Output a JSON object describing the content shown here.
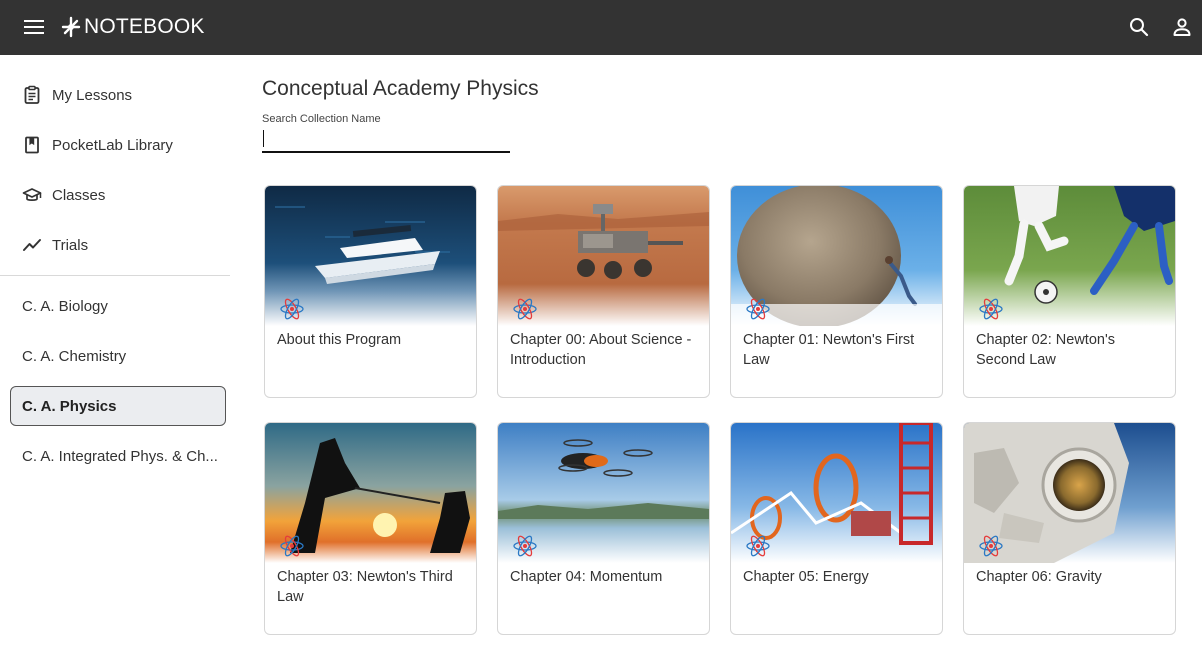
{
  "app": {
    "name": "NOTEBOOK"
  },
  "sidebar": {
    "nav": [
      {
        "label": "My Lessons",
        "icon": "clipboard-icon"
      },
      {
        "label": "PocketLab Library",
        "icon": "book-icon"
      },
      {
        "label": "Classes",
        "icon": "graduation-cap-icon"
      },
      {
        "label": "Trials",
        "icon": "trend-line-icon"
      }
    ],
    "collections": [
      {
        "label": "C. A. Biology",
        "active": false
      },
      {
        "label": "C. A. Chemistry",
        "active": false
      },
      {
        "label": "C. A. Physics",
        "active": true
      },
      {
        "label": "C. A. Integrated Phys. & Ch...",
        "active": false
      }
    ]
  },
  "main": {
    "title": "Conceptual Academy Physics",
    "search": {
      "label": "Search Collection Name",
      "value": "",
      "placeholder": ""
    },
    "cards": [
      {
        "title": "About this Program",
        "image": "catamaran-at-sea"
      },
      {
        "title": "Chapter 00: About Science - Introduction",
        "image": "mars-rover"
      },
      {
        "title": "Chapter 01: Newton's First Law",
        "image": "person-pushing-boulder"
      },
      {
        "title": "Chapter 02: Newton's Second Law",
        "image": "soccer-players"
      },
      {
        "title": "Chapter 03: Newton's Third Law",
        "image": "tug-of-war-sunset"
      },
      {
        "title": "Chapter 04: Momentum",
        "image": "drone-over-lake"
      },
      {
        "title": "Chapter 05: Energy",
        "image": "roller-coaster"
      },
      {
        "title": "Chapter 06: Gravity",
        "image": "astronaut-in-space"
      }
    ]
  },
  "colors": {
    "topbar": "#333333",
    "active_item_bg": "#ebedf0"
  }
}
